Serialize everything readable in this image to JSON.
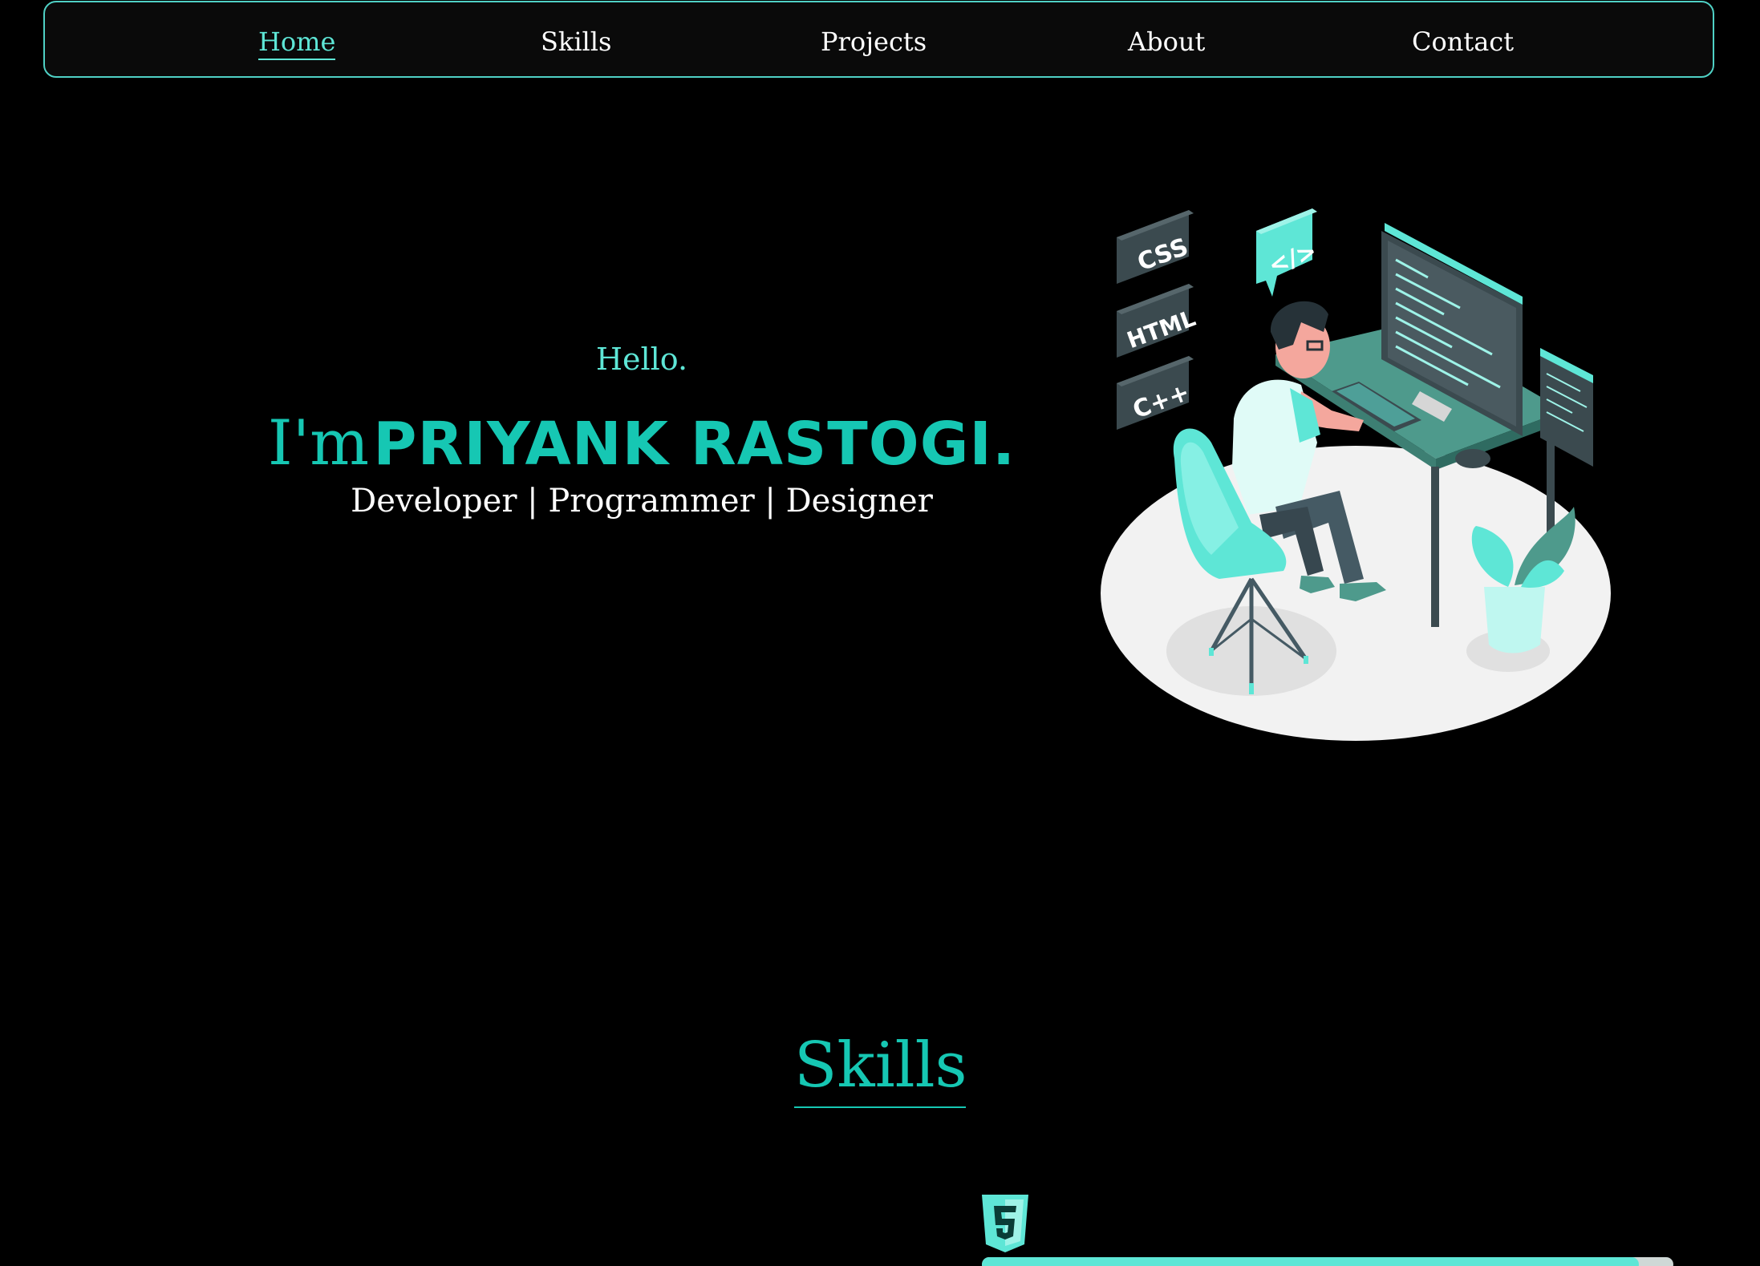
{
  "nav": {
    "items": [
      {
        "label": "Home",
        "active": true
      },
      {
        "label": "Skills",
        "active": false
      },
      {
        "label": "Projects",
        "active": false
      },
      {
        "label": "About",
        "active": false
      },
      {
        "label": "Contact",
        "active": false
      }
    ]
  },
  "hero": {
    "greeting": "Hello.",
    "intro_prefix": "I'm",
    "name": "PRIYANK RASTOGI.",
    "roles": "Developer | Programmer | Designer",
    "illustration_badges": [
      "CSS",
      "HTML",
      "C++",
      "</>"
    ]
  },
  "skills": {
    "title": "Skills",
    "items": [
      {
        "icon": "html5-icon",
        "level_fraction": 0.95
      }
    ]
  },
  "colors": {
    "accent": "#16c7b3",
    "accent_light": "#5ee6d6",
    "background": "#000000",
    "text": "#ffffff"
  }
}
